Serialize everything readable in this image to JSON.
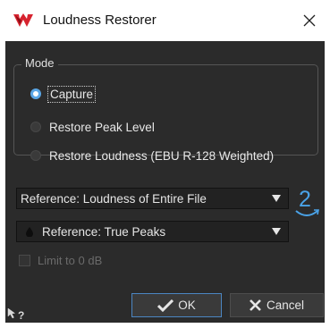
{
  "window": {
    "title": "Loudness Restorer",
    "close_glyph": "✕"
  },
  "mode": {
    "group_label": "Mode",
    "options": [
      {
        "label": "Capture",
        "selected": true
      },
      {
        "label": "Restore Peak Level",
        "selected": false
      },
      {
        "label": "Restore Loudness (EBU R-128 Weighted)",
        "selected": false
      }
    ]
  },
  "reference_loudness": {
    "value": "Reference: Loudness of Entire File"
  },
  "reference_peaks": {
    "value": "Reference: True Peaks",
    "icon": "drop-icon"
  },
  "step_badge": {
    "number": "2"
  },
  "limit": {
    "label": "Limit to 0 dB",
    "checked": false,
    "enabled": false
  },
  "buttons": {
    "ok_label": "OK",
    "cancel_label": "Cancel"
  },
  "help": {
    "glyph": "?"
  },
  "colors": {
    "accent": "#5aa6e6",
    "brand_red": "#d7232f",
    "panel_bg": "#2b2b2b"
  }
}
